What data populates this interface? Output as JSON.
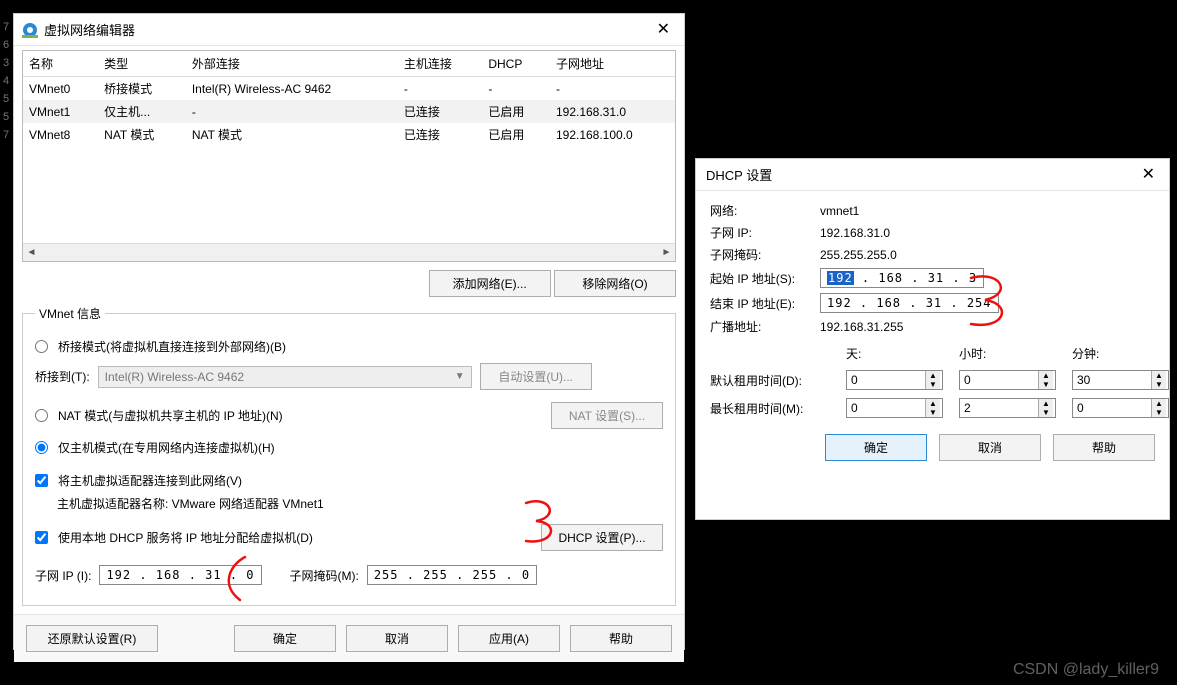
{
  "gutter": {
    "lines": [
      "7",
      "6",
      "",
      "",
      "",
      "",
      "3",
      "4",
      "5",
      "5",
      "7"
    ]
  },
  "main": {
    "title": "虚拟网络编辑器",
    "table": {
      "headers": [
        "名称",
        "类型",
        "外部连接",
        "主机连接",
        "DHCP",
        "子网地址"
      ],
      "rows": [
        {
          "name": "VMnet0",
          "type": "桥接模式",
          "ext": "Intel(R) Wireless-AC 9462",
          "host": "-",
          "dhcp": "-",
          "subnet": "-"
        },
        {
          "name": "VMnet1",
          "type": "仅主机...",
          "ext": "-",
          "host": "已连接",
          "dhcp": "已启用",
          "subnet": "192.168.31.0",
          "sel": true
        },
        {
          "name": "VMnet8",
          "type": "NAT 模式",
          "ext": "NAT 模式",
          "host": "已连接",
          "dhcp": "已启用",
          "subnet": "192.168.100.0"
        }
      ]
    },
    "buttons": {
      "add": "添加网络(E)...",
      "remove": "移除网络(O)"
    },
    "fieldset": {
      "legend": "VMnet 信息",
      "bridge": "桥接模式(将虚拟机直接连接到外部网络)(B)",
      "bridgeToLabel": "桥接到(T):",
      "bridgeToValue": "Intel(R) Wireless-AC 9462",
      "autoSet": "自动设置(U)...",
      "nat": "NAT 模式(与虚拟机共享主机的 IP 地址)(N)",
      "natSet": "NAT 设置(S)...",
      "hostOnly": "仅主机模式(在专用网络内连接虚拟机)(H)",
      "connectHost": "将主机虚拟适配器连接到此网络(V)",
      "hostAdapterLabel": "主机虚拟适配器名称: VMware 网络适配器 VMnet1",
      "useDhcp": "使用本地 DHCP 服务将 IP 地址分配给虚拟机(D)",
      "dhcpSet": "DHCP 设置(P)...",
      "subnetIpLabel": "子网 IP (I):",
      "subnetIp": "192 . 168 . 31 .  0",
      "subnetMaskLabel": "子网掩码(M):",
      "subnetMask": "255 . 255 . 255 .  0"
    },
    "footer": {
      "restore": "还原默认设置(R)",
      "ok": "确定",
      "cancel": "取消",
      "apply": "应用(A)",
      "help": "帮助"
    }
  },
  "dhcp": {
    "title": "DHCP 设置",
    "fields": {
      "network": {
        "k": "网络:",
        "v": "vmnet1"
      },
      "subnetIp": {
        "k": "子网 IP:",
        "v": "192.168.31.0"
      },
      "subnetMask": {
        "k": "子网掩码:",
        "v": "255.255.255.0"
      },
      "startIp": {
        "k": "起始 IP 地址(S):",
        "sel": "192",
        "rest": " . 168 . 31 .  3"
      },
      "endIp": {
        "k": "结束 IP 地址(E):",
        "v": "192 . 168 . 31 . 254"
      },
      "broadcast": {
        "k": "广播地址:",
        "v": "192.168.31.255"
      },
      "headers": {
        "day": "天:",
        "hour": "小时:",
        "min": "分钟:"
      },
      "defaultLease": {
        "k": "默认租用时间(D):",
        "d": "0",
        "h": "0",
        "m": "30"
      },
      "maxLease": {
        "k": "最长租用时间(M):",
        "d": "0",
        "h": "2",
        "m": "0"
      }
    },
    "footer": {
      "ok": "确定",
      "cancel": "取消",
      "help": "帮助"
    }
  },
  "watermark": "CSDN @lady_killer9"
}
